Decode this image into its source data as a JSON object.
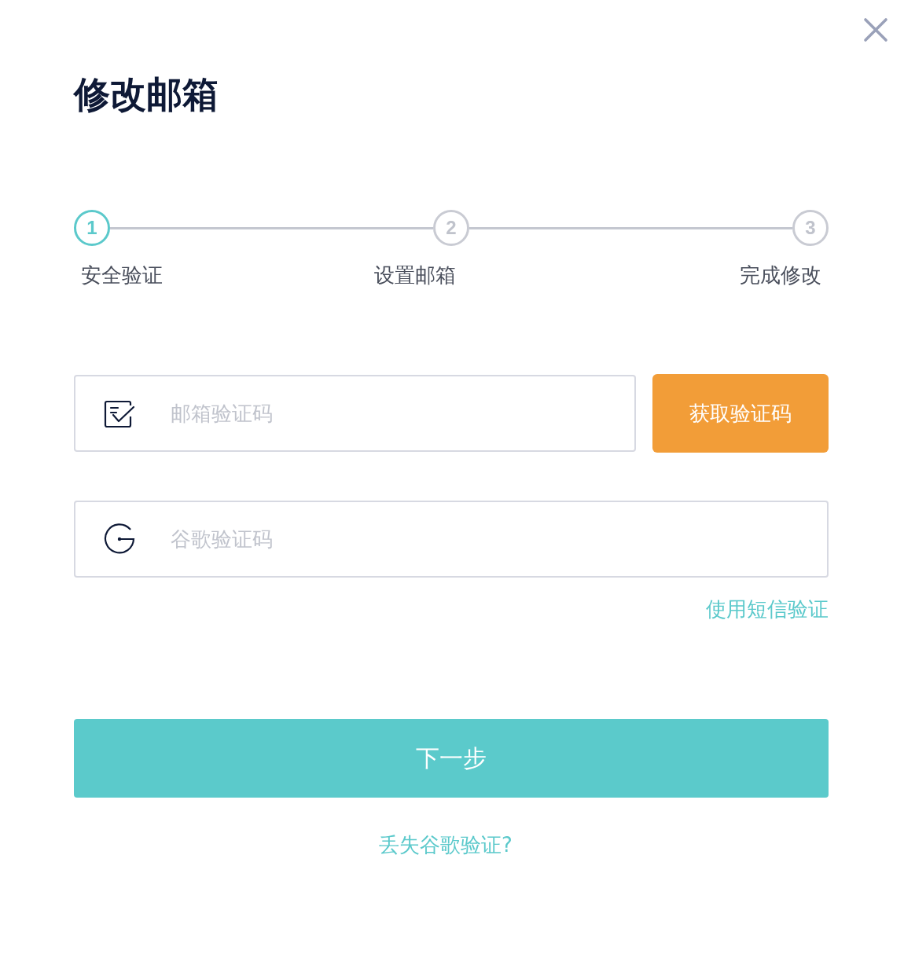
{
  "title": "修改邮箱",
  "steps": [
    {
      "number": "1",
      "label": "安全验证",
      "selected": true
    },
    {
      "number": "2",
      "label": "设置邮箱",
      "selected": false
    },
    {
      "number": "3",
      "label": "完成修改",
      "selected": false
    }
  ],
  "fields": [
    {
      "kind": "email-code",
      "placeholder": "邮箱验证码",
      "button": "获取验证码"
    },
    {
      "kind": "google-code",
      "placeholder": "谷歌验证码"
    }
  ],
  "sms_link": "使用短信验证",
  "next_button": "下一步",
  "lost_link": "丢失谷歌验证?"
}
